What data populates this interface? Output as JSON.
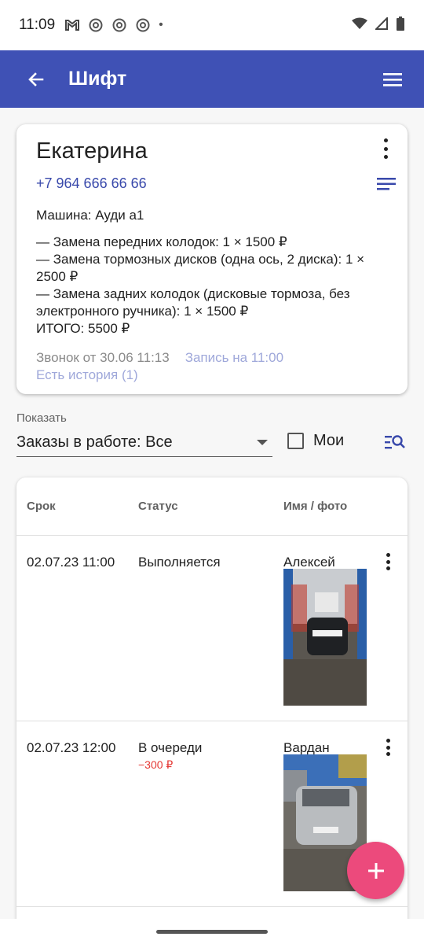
{
  "status_bar": {
    "time": "11:09",
    "notifications": [
      "gmail-icon",
      "chrome-icon",
      "chrome-icon",
      "chrome-icon"
    ],
    "more_dot": "•"
  },
  "app_bar": {
    "title": "Шифт",
    "color": "#3f51b5"
  },
  "client_card": {
    "name": "Екатерина",
    "phone": "+7 964 666 66 66",
    "car": "Машина: Ауди а1",
    "description": "— Замена передних колодок: 1 × 1500 ₽\n— Замена тормозных дисков (одна ось, 2 диска): 1 × 2500 ₽\n— Замена задних колодок (дисковые тормоза, без электронного ручника): 1 × 1500 ₽\nИТОГО: 5500 ₽",
    "call_info": "Звонок от 30.06 11:13",
    "appointment": "Запись на 11:00",
    "history": "Есть история (1)"
  },
  "filter": {
    "label": "Показать",
    "selected": "Заказы в работе: Все",
    "mine_label": "Мои",
    "mine_checked": false
  },
  "table": {
    "headers": {
      "deadline": "Срок",
      "status": "Статус",
      "name_photo": "Имя / фото"
    },
    "rows": [
      {
        "deadline": "02.07.23 11:00",
        "status": "Выполняется",
        "amount": "",
        "name": "Алексей",
        "photo": "car-black-photo"
      },
      {
        "deadline": "02.07.23 12:00",
        "status": "В очереди",
        "amount": "−300 ₽",
        "name": "Вардан",
        "photo": "car-silver-photo"
      }
    ]
  },
  "fab": {
    "icon": "plus-icon",
    "color": "#ec4a7c"
  }
}
